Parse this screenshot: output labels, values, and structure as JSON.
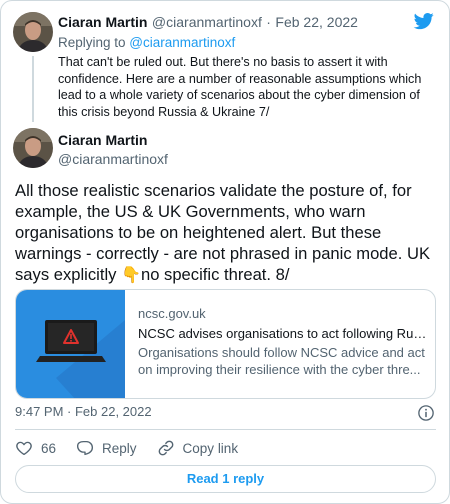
{
  "reply_tweet": {
    "name": "Ciaran Martin",
    "handle": "@ciaranmartinoxf",
    "separator": "·",
    "date": "Feb 22, 2022",
    "replying_prefix": "Replying to ",
    "replying_to": "@ciaranmartinoxf",
    "text": "That can't be ruled out. But there's no basis to assert it with confidence. Here are a number of reasonable assumptions which lead to a whole variety of scenarios about the cyber dimension of this crisis beyond Russia & Ukraine 7/"
  },
  "main_tweet": {
    "name": "Ciaran Martin",
    "handle": "@ciaranmartinoxf",
    "text_before_emoji": "All those realistic scenarios validate the posture of, for example, the US & UK Governments, who warn organisations to be on heightened alert. But these warnings - correctly - are not phrased in panic mode. UK says explicitly ",
    "emoji": "👇",
    "text_after_emoji": "no specific threat. 8/",
    "timestamp": "9:47 PM · Feb 22, 2022"
  },
  "link_card": {
    "domain": "ncsc.gov.uk",
    "title": "NCSC advises organisations to act following Russ...",
    "description": "Organisations should follow NCSC advice and act on improving their resilience with the cyber thre..."
  },
  "actions": {
    "like_count": "66",
    "reply_label": "Reply",
    "copy_link_label": "Copy link"
  },
  "read_reply_label": "Read 1 reply",
  "colors": {
    "brand_blue": "#1d9bf0",
    "secondary_text": "#536471",
    "border": "#cfd9de",
    "thumb_bg": "#2a8de0"
  }
}
